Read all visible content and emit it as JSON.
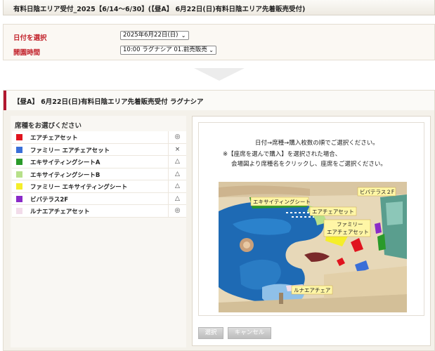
{
  "header": {
    "title": "有料日陰エリア受付_2025【6/14〜6/30】(【昼A】 6月22日(日)有料日陰エリア先着販売受付)"
  },
  "selection": {
    "date_label": "日付を選択",
    "date_value": "2025年6月22日(日)",
    "time_label": "開園時間",
    "time_value": "10:00 ラグナシア 01.前売販売"
  },
  "section": {
    "title": "【昼A】 6月22日(日)有料日陰エリア先着販売受付 ラグナシア",
    "seat_panel_title": "席種をお選びください",
    "seats": [
      {
        "name": "エアチェアセット",
        "color": "#e0141e",
        "status": "◎"
      },
      {
        "name": "ファミリー エアチェアセット",
        "color": "#3a6fd8",
        "status": "×"
      },
      {
        "name": "エキサイティングシートA",
        "color": "#2a9a2a",
        "status": "△"
      },
      {
        "name": "エキサイティングシートB",
        "color": "#b7e08a",
        "status": "△"
      },
      {
        "name": "ファミリー エキサイティングシート",
        "color": "#f5ee2a",
        "status": "△"
      },
      {
        "name": "ビバテラス2F",
        "color": "#8a2ac8",
        "status": "△"
      },
      {
        "name": "ルナエアチェアセット",
        "color": "#f2dcea",
        "status": "◎"
      }
    ],
    "instructions": {
      "line1": "日付→席種→購入枚数の順でご選択ください。",
      "line2": "※【座席を選んで購入】を選択された場合、",
      "line3": "会場図より席種名をクリックし、座席をご選択ください。"
    },
    "map_labels": {
      "exciting": "エキサイティングシート",
      "viva": "ビバテラス２F",
      "airchair": "エアチェアセット",
      "family1": "ファミリー",
      "family2": "エアチェアセット",
      "luna": "ルナエアチェア"
    },
    "buttons": {
      "select": "選択",
      "cancel": "キャンセル"
    }
  }
}
